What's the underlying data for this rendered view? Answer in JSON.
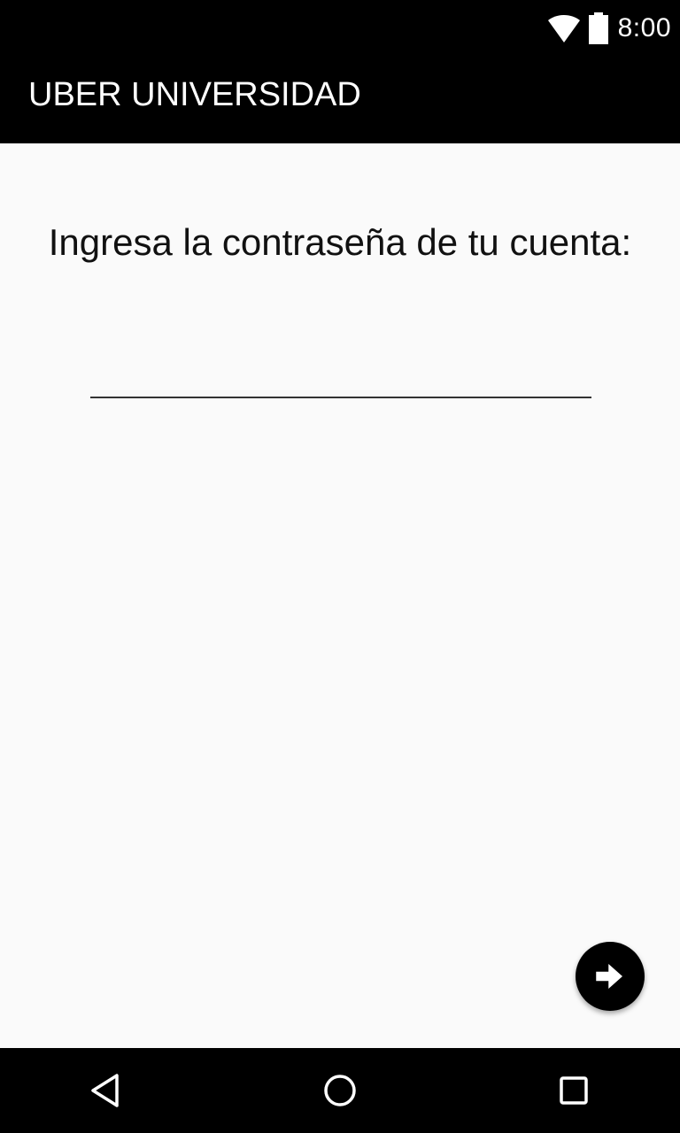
{
  "status_bar": {
    "time": "8:00",
    "icons": [
      "wifi-icon",
      "battery-icon"
    ]
  },
  "app_bar": {
    "title": "UBER UNIVERSIDAD"
  },
  "content": {
    "prompt": "Ingresa la contraseña de tu cuenta:",
    "password_value": "",
    "password_placeholder": ""
  },
  "fab": {
    "icon": "arrow-right-icon"
  },
  "nav_bar": {
    "icons": [
      "back-icon",
      "home-icon",
      "recents-icon"
    ]
  },
  "colors": {
    "bar_background": "#000000",
    "screen_background": "#fafafa",
    "text": "#111111"
  }
}
